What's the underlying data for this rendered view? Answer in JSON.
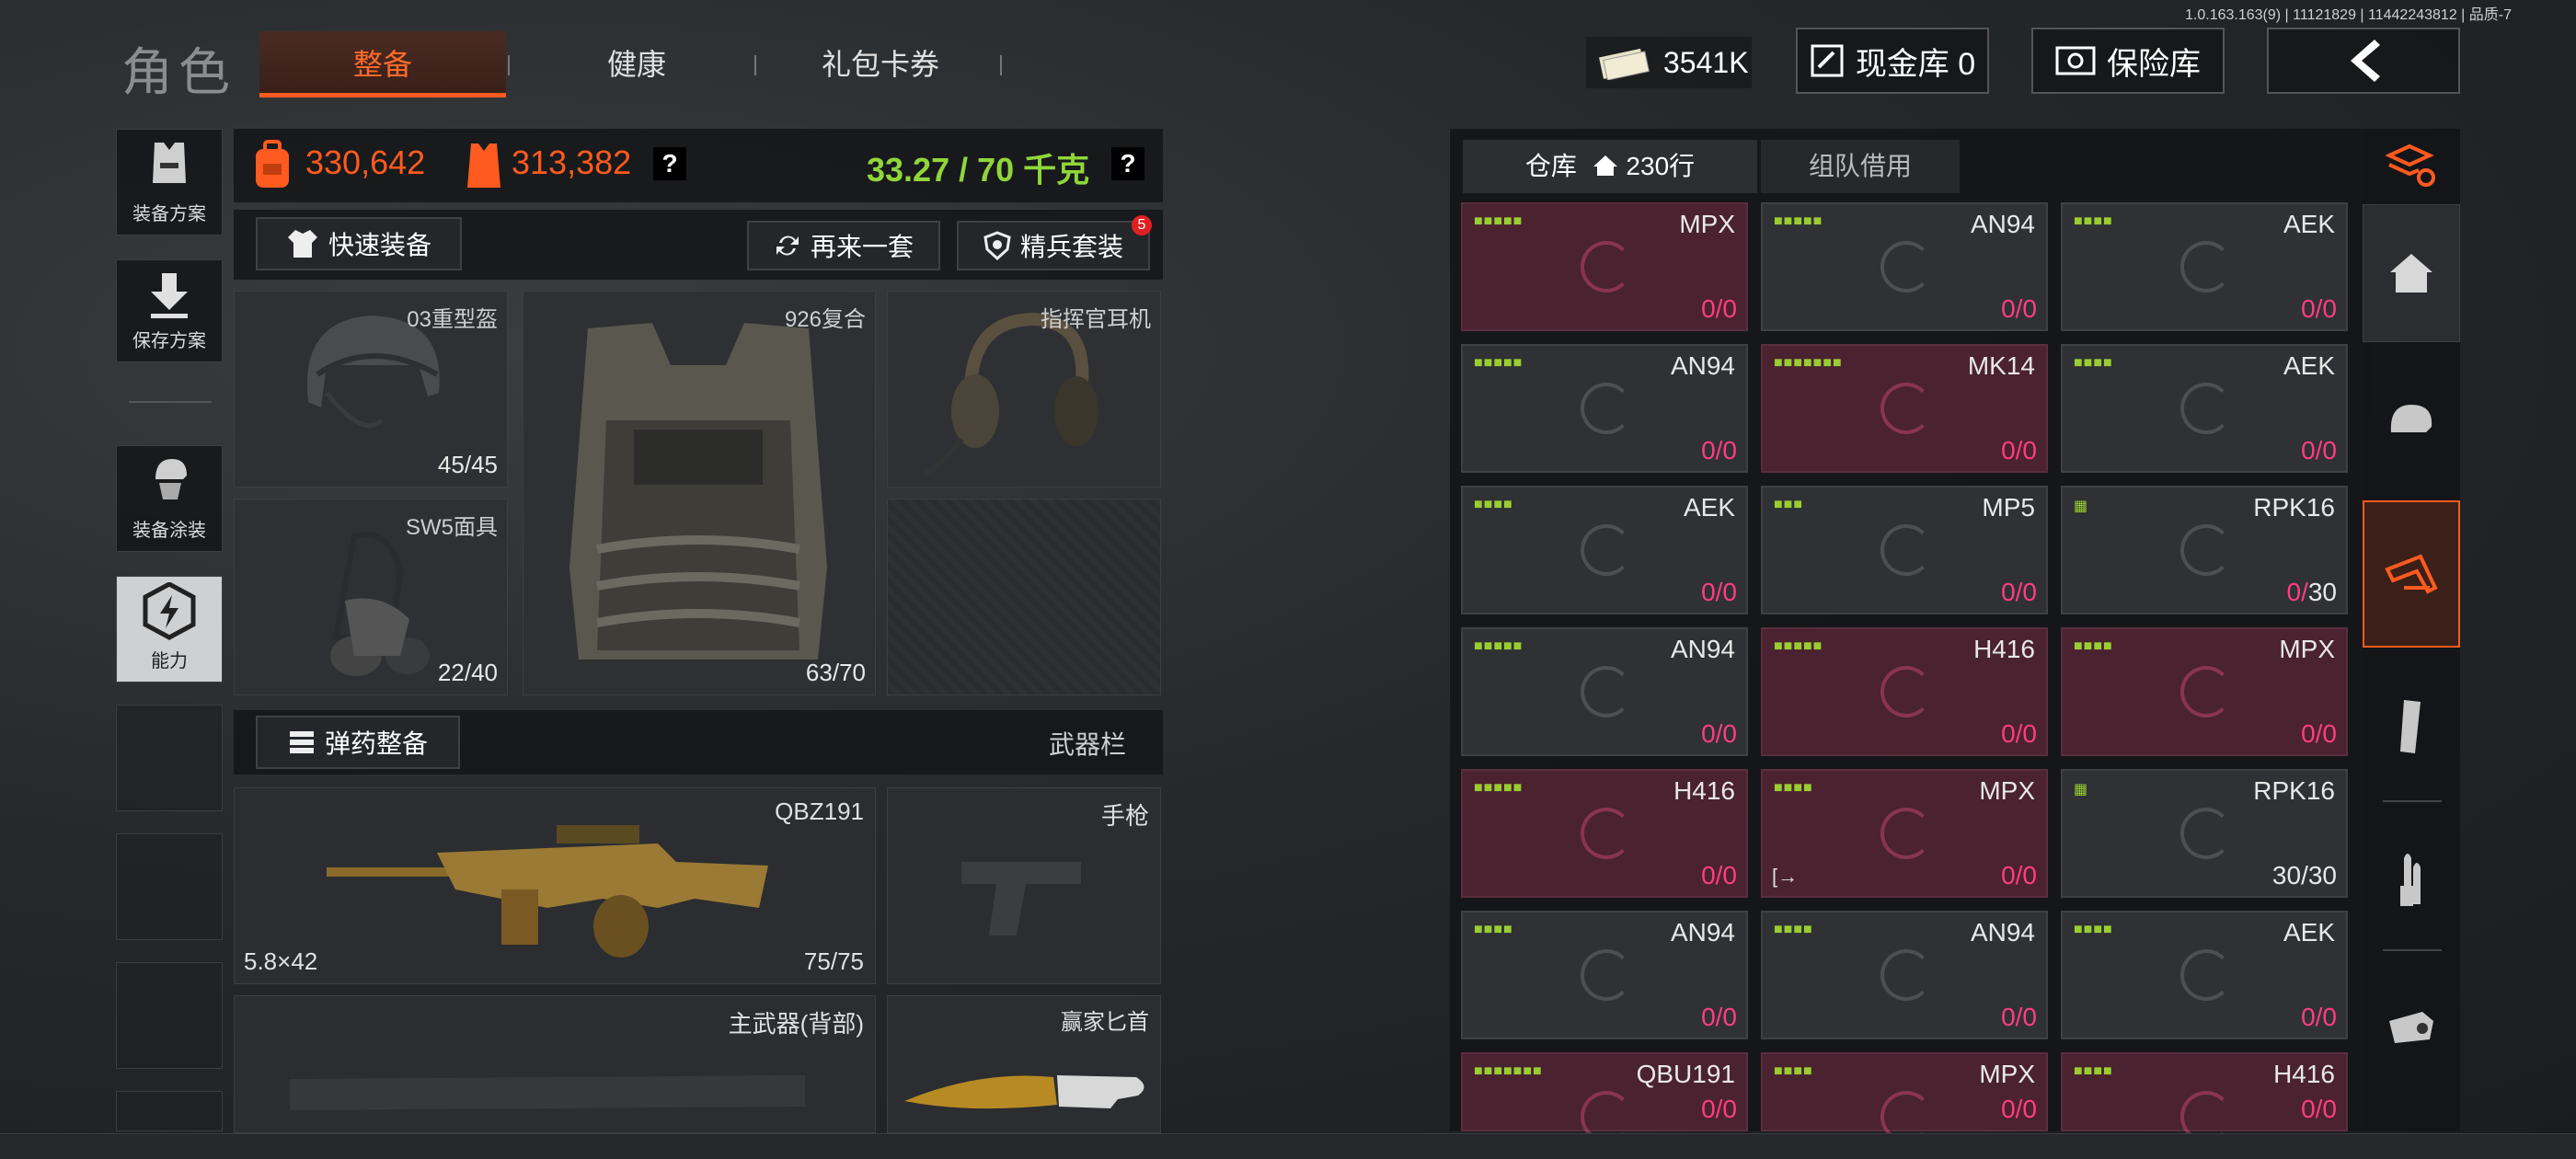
{
  "version": "1.0.163.163(9) | 11121829 | 11442243812 | 品质-7",
  "title": "角色",
  "tabs": [
    {
      "label": "整备",
      "active": true
    },
    {
      "label": "健康",
      "active": false
    },
    {
      "label": "礼包卡券",
      "active": false
    }
  ],
  "money": "3541K",
  "cash_vault": "现金库 0",
  "safe_vault": "保险库",
  "left_side": [
    {
      "label": "装备方案",
      "icon": "vest-plan-icon"
    },
    {
      "label": "保存方案",
      "icon": "download-icon"
    },
    {
      "label": "装备涂装",
      "icon": "paint-icon"
    },
    {
      "label": "能力",
      "icon": "ability-icon"
    }
  ],
  "stats": {
    "value1": "330,642",
    "value2": "313,382",
    "weight": "33.27 / 70 千克",
    "help": "?"
  },
  "buttons": {
    "quick": "快速装备",
    "again": "再来一套",
    "elite": "精兵套装",
    "elite_badge": "5",
    "ammo": "弹药整备"
  },
  "gear": {
    "helmet": {
      "name": "03重型盔",
      "dur": "45/45"
    },
    "mask": {
      "name": "SW5面具",
      "dur": "22/40"
    },
    "vest": {
      "name": "926复合",
      "dur": "63/70"
    },
    "headset": {
      "name": "指挥官耳机"
    }
  },
  "weapons": {
    "header": "武器栏",
    "primary": {
      "name": "QBZ191",
      "caliber": "5.8×42",
      "ammo": "75/75"
    },
    "pistol": {
      "name": "手枪"
    },
    "secondary": {
      "name": "主武器(背部)"
    },
    "knife": {
      "name": "赢家匕首"
    }
  },
  "storage": {
    "tab1": "仓库",
    "tab1_count": "230行",
    "tab2": "组队借用",
    "items": [
      {
        "name": "MPX",
        "dots": "■■■■■",
        "red": true,
        "cur": "0",
        "max": "0"
      },
      {
        "name": "AN94",
        "dots": "■■■■■",
        "red": false,
        "cur": "0",
        "max": "0"
      },
      {
        "name": "AEK",
        "dots": "■■■■",
        "red": false,
        "cur": "0",
        "max": "0"
      },
      {
        "name": "AN94",
        "dots": "■■■■■",
        "red": false,
        "cur": "0",
        "max": "0"
      },
      {
        "name": "MK14",
        "dots": "■■■■■■■",
        "red": true,
        "cur": "0",
        "max": "0"
      },
      {
        "name": "AEK",
        "dots": "■■■■",
        "red": false,
        "cur": "0",
        "max": "0"
      },
      {
        "name": "AEK",
        "dots": "■■■■",
        "red": false,
        "cur": "0",
        "max": "0"
      },
      {
        "name": "MP5",
        "dots": "■■■",
        "red": false,
        "cur": "0",
        "max": "0"
      },
      {
        "name": "RPK16",
        "dots": "▦",
        "red": false,
        "cur": "0",
        "max": "30"
      },
      {
        "name": "AN94",
        "dots": "■■■■■",
        "red": false,
        "cur": "0",
        "max": "0"
      },
      {
        "name": "H416",
        "dots": "■■■■■",
        "red": true,
        "cur": "0",
        "max": "0"
      },
      {
        "name": "MPX",
        "dots": "■■■■",
        "red": true,
        "cur": "0",
        "max": "0"
      },
      {
        "name": "H416",
        "dots": "■■■■■",
        "red": true,
        "cur": "0",
        "max": "0"
      },
      {
        "name": "MPX",
        "dots": "■■■■",
        "red": true,
        "cur": "0",
        "max": "0",
        "exit": "[→"
      },
      {
        "name": "RPK16",
        "dots": "▦",
        "red": false,
        "cur": "30",
        "max": "30"
      },
      {
        "name": "AN94",
        "dots": "■■■■",
        "red": false,
        "cur": "0",
        "max": "0"
      },
      {
        "name": "AN94",
        "dots": "■■■■",
        "red": false,
        "cur": "0",
        "max": "0"
      },
      {
        "name": "AEK",
        "dots": "■■■■",
        "red": false,
        "cur": "0",
        "max": "0"
      },
      {
        "name": "QBU191",
        "dots": "■■■■■■■",
        "red": true,
        "cur": "0",
        "max": "0"
      },
      {
        "name": "MPX",
        "dots": "■■■■",
        "red": true,
        "cur": "0",
        "max": "0"
      },
      {
        "name": "H416",
        "dots": "■■■■",
        "red": true,
        "cur": "0",
        "max": "0"
      }
    ]
  },
  "right_side": [
    {
      "icon": "refresh-stack-icon"
    },
    {
      "icon": "home-icon"
    },
    {
      "icon": "helmet-icon"
    },
    {
      "icon": "weapon-icon",
      "active": true
    },
    {
      "icon": "magazine-icon"
    },
    {
      "icon": "bullet-icon"
    },
    {
      "icon": "scope-icon"
    }
  ],
  "colors": {
    "accent": "#ff5a1f",
    "green": "#8fd63a",
    "pink": "#ff3d7f"
  }
}
